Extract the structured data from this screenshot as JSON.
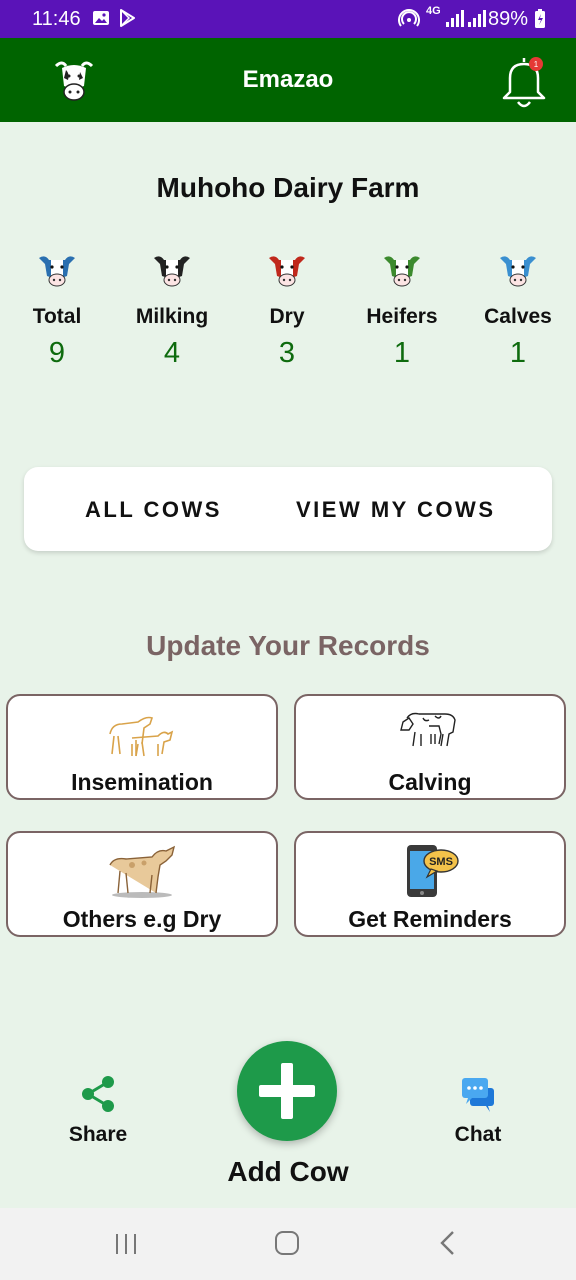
{
  "status_bar": {
    "time": "11:46",
    "network": "4G",
    "battery": "89%"
  },
  "app_bar": {
    "title": "Emazao",
    "notification_count": "1",
    "logo_icon": "cow-head-icon",
    "bell_icon": "bell-icon"
  },
  "farm_name": "Muhoho Dairy Farm",
  "stats": [
    {
      "label": "Total",
      "value": "9",
      "icon_color": "#2a6fb0"
    },
    {
      "label": "Milking",
      "value": "4",
      "icon_color": "#222222"
    },
    {
      "label": "Dry",
      "value": "3",
      "icon_color": "#c0281c"
    },
    {
      "label": "Heifers",
      "value": "1",
      "icon_color": "#3c8a2e"
    },
    {
      "label": "Calves",
      "value": "1",
      "icon_color": "#3a8fd0"
    }
  ],
  "buttons": {
    "all_cows": "ALL COWS",
    "view_my_cows": "VIEW MY COWS"
  },
  "section_title": "Update Your Records",
  "records": [
    {
      "label": "Insemination",
      "icon": "insemination-icon"
    },
    {
      "label": "Calving",
      "icon": "calving-icon"
    },
    {
      "label": "Others e.g Dry",
      "icon": "calf-icon"
    },
    {
      "label": "Get Reminders",
      "icon": "sms-phone-icon",
      "badge_text": "SMS"
    }
  ],
  "bottom": {
    "share": "Share",
    "add_cow": "Add Cow",
    "chat": "Chat"
  },
  "colors": {
    "status_bar": "#5a13b8",
    "app_bar": "#006400",
    "background": "#e8f3e9",
    "stat_value": "#0e6b0e",
    "section_title": "#7a6464",
    "fab": "#1e9a4a"
  }
}
